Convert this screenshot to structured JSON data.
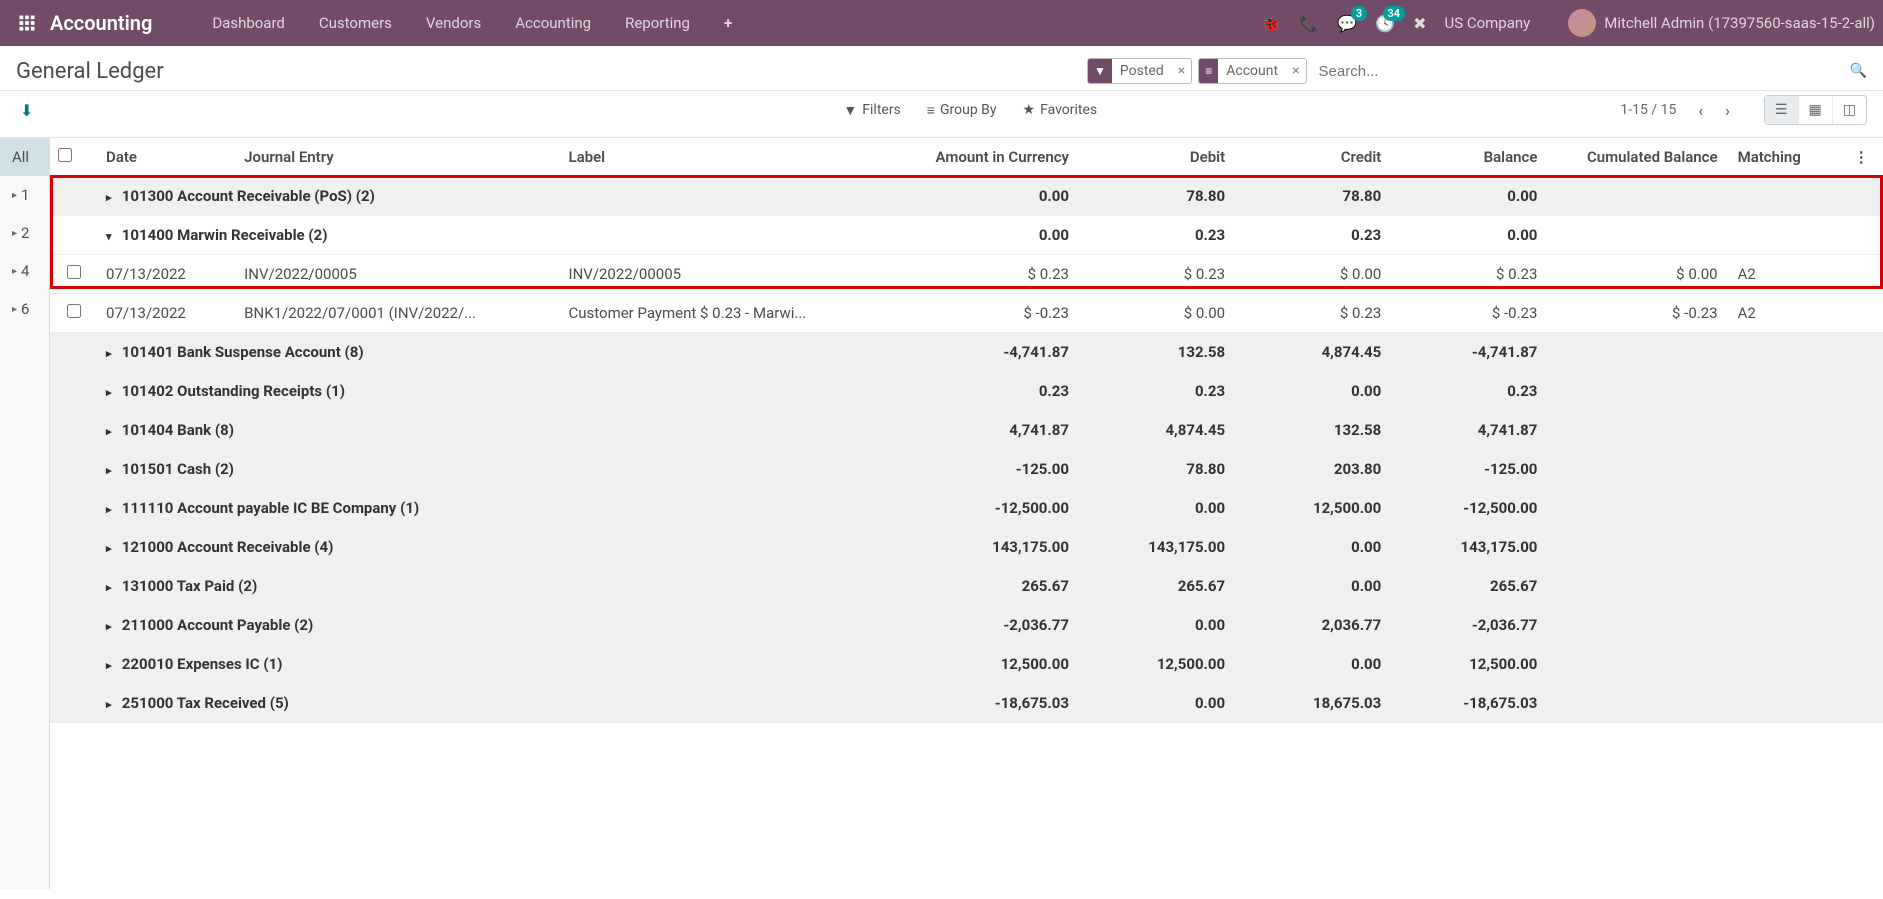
{
  "nav": {
    "brand": "Accounting",
    "items": [
      "Dashboard",
      "Customers",
      "Vendors",
      "Accounting",
      "Reporting"
    ],
    "msg_badge": "3",
    "activity_badge": "34",
    "company": "US Company",
    "user": "Mitchell Admin (17397560-saas-15-2-all)"
  },
  "page": {
    "title": "General Ledger",
    "facets": [
      {
        "icon": "filter",
        "label": "Posted"
      },
      {
        "icon": "list",
        "label": "Account"
      }
    ],
    "search_placeholder": "Search...",
    "filters": "Filters",
    "groupby": "Group By",
    "favorites": "Favorites",
    "pager": "1-15 / 15"
  },
  "columns": {
    "date": "Date",
    "journal": "Journal Entry",
    "label": "Label",
    "amt": "Amount in Currency",
    "debit": "Debit",
    "credit": "Credit",
    "balance": "Balance",
    "cumulated": "Cumulated Balance",
    "matching": "Matching"
  },
  "sidebar": {
    "all": "All",
    "n1": "1",
    "n2": "2",
    "n4": "4",
    "n6": "6"
  },
  "groups": [
    {
      "name": "101300 Account Receivable (PoS) (2)",
      "amt": "0.00",
      "debit": "78.80",
      "credit": "78.80",
      "bal": "0.00"
    },
    {
      "name": "101400 Marwin Receivable (2)",
      "open": true,
      "amt": "0.00",
      "debit": "0.23",
      "credit": "0.23",
      "bal": "0.00",
      "rows": [
        {
          "date": "07/13/2022",
          "journal": "INV/2022/00005",
          "label": "INV/2022/00005",
          "amt": "$ 0.23",
          "debit": "$ 0.23",
          "credit": "$ 0.00",
          "bal": "$ 0.23",
          "cum": "$ 0.00",
          "match": "A2"
        },
        {
          "date": "07/13/2022",
          "journal": "BNK1/2022/07/0001 (INV/2022/...",
          "label": "Customer Payment $ 0.23 - Marwi...",
          "amt": "$ -0.23",
          "debit": "$ 0.00",
          "credit": "$ 0.23",
          "bal": "$ -0.23",
          "cum": "$ -0.23",
          "match": "A2"
        }
      ]
    },
    {
      "name": "101401 Bank Suspense Account (8)",
      "amt": "-4,741.87",
      "debit": "132.58",
      "credit": "4,874.45",
      "bal": "-4,741.87"
    },
    {
      "name": "101402 Outstanding Receipts (1)",
      "amt": "0.23",
      "debit": "0.23",
      "credit": "0.00",
      "bal": "0.23"
    },
    {
      "name": "101404 Bank (8)",
      "amt": "4,741.87",
      "debit": "4,874.45",
      "credit": "132.58",
      "bal": "4,741.87"
    },
    {
      "name": "101501 Cash (2)",
      "amt": "-125.00",
      "debit": "78.80",
      "credit": "203.80",
      "bal": "-125.00"
    },
    {
      "name": "111110 Account payable IC BE Company (1)",
      "amt": "-12,500.00",
      "debit": "0.00",
      "credit": "12,500.00",
      "bal": "-12,500.00"
    },
    {
      "name": "121000 Account Receivable (4)",
      "amt": "143,175.00",
      "debit": "143,175.00",
      "credit": "0.00",
      "bal": "143,175.00"
    },
    {
      "name": "131000 Tax Paid (2)",
      "amt": "265.67",
      "debit": "265.67",
      "credit": "0.00",
      "bal": "265.67"
    },
    {
      "name": "211000 Account Payable (2)",
      "amt": "-2,036.77",
      "debit": "0.00",
      "credit": "2,036.77",
      "bal": "-2,036.77"
    },
    {
      "name": "220010 Expenses IC (1)",
      "amt": "12,500.00",
      "debit": "12,500.00",
      "credit": "0.00",
      "bal": "12,500.00"
    },
    {
      "name": "251000 Tax Received (5)",
      "amt": "-18,675.03",
      "debit": "0.00",
      "credit": "18,675.03",
      "bal": "-18,675.03"
    }
  ]
}
